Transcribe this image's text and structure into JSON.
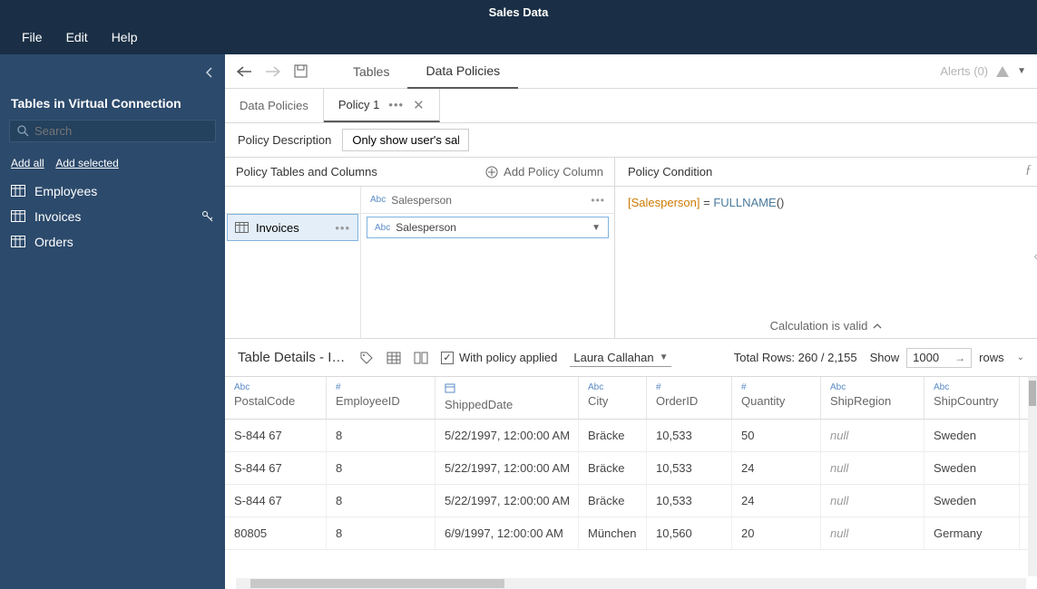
{
  "app_title": "Sales Data",
  "menu": {
    "file": "File",
    "edit": "Edit",
    "help": "Help"
  },
  "sidebar": {
    "title": "Tables in Virtual Connection",
    "search_placeholder": "Search",
    "add_all": "Add all",
    "add_selected": "Add selected",
    "items": [
      {
        "label": "Employees",
        "has_key": false
      },
      {
        "label": "Invoices",
        "has_key": true
      },
      {
        "label": "Orders",
        "has_key": false
      }
    ]
  },
  "tabs": {
    "tables": "Tables",
    "policies": "Data Policies"
  },
  "alerts_label": "Alerts (0)",
  "policy_tabs": {
    "list": "Data Policies",
    "active": "Policy 1"
  },
  "policy_desc": {
    "label": "Policy Description",
    "value": "Only show user's sales"
  },
  "policy_tables": {
    "header": "Policy Tables and Columns",
    "add_col": "Add Policy Column",
    "column_header": "Salesperson",
    "table_name": "Invoices",
    "selected_column": "Salesperson"
  },
  "policy_condition": {
    "header": "Policy Condition",
    "field": "[Salesperson]",
    "eq": " = ",
    "fn": "FULLNAME",
    "parens": "()",
    "valid": "Calculation is valid"
  },
  "details": {
    "title": "Table Details - In...",
    "with_policy": "With policy applied",
    "user": "Laura Callahan",
    "total_rows": "Total Rows: 260 / 2,155",
    "show": "Show",
    "count": "1000",
    "rows": "rows"
  },
  "grid": {
    "columns": [
      {
        "type": "Abc",
        "name": "PostalCode"
      },
      {
        "type": "#",
        "name": "EmployeeID"
      },
      {
        "type": "date",
        "name": "ShippedDate"
      },
      {
        "type": "Abc",
        "name": "City"
      },
      {
        "type": "#",
        "name": "OrderID"
      },
      {
        "type": "#",
        "name": "Quantity"
      },
      {
        "type": "Abc",
        "name": "ShipRegion"
      },
      {
        "type": "Abc",
        "name": "ShipCountry"
      }
    ],
    "rows": [
      [
        "S-844 67",
        "8",
        "5/22/1997, 12:00:00 AM",
        "Bräcke",
        "10,533",
        "50",
        "null",
        "Sweden"
      ],
      [
        "S-844 67",
        "8",
        "5/22/1997, 12:00:00 AM",
        "Bräcke",
        "10,533",
        "24",
        "null",
        "Sweden"
      ],
      [
        "S-844 67",
        "8",
        "5/22/1997, 12:00:00 AM",
        "Bräcke",
        "10,533",
        "24",
        "null",
        "Sweden"
      ],
      [
        "80805",
        "8",
        "6/9/1997, 12:00:00 AM",
        "München",
        "10,560",
        "20",
        "null",
        "Germany"
      ]
    ]
  }
}
